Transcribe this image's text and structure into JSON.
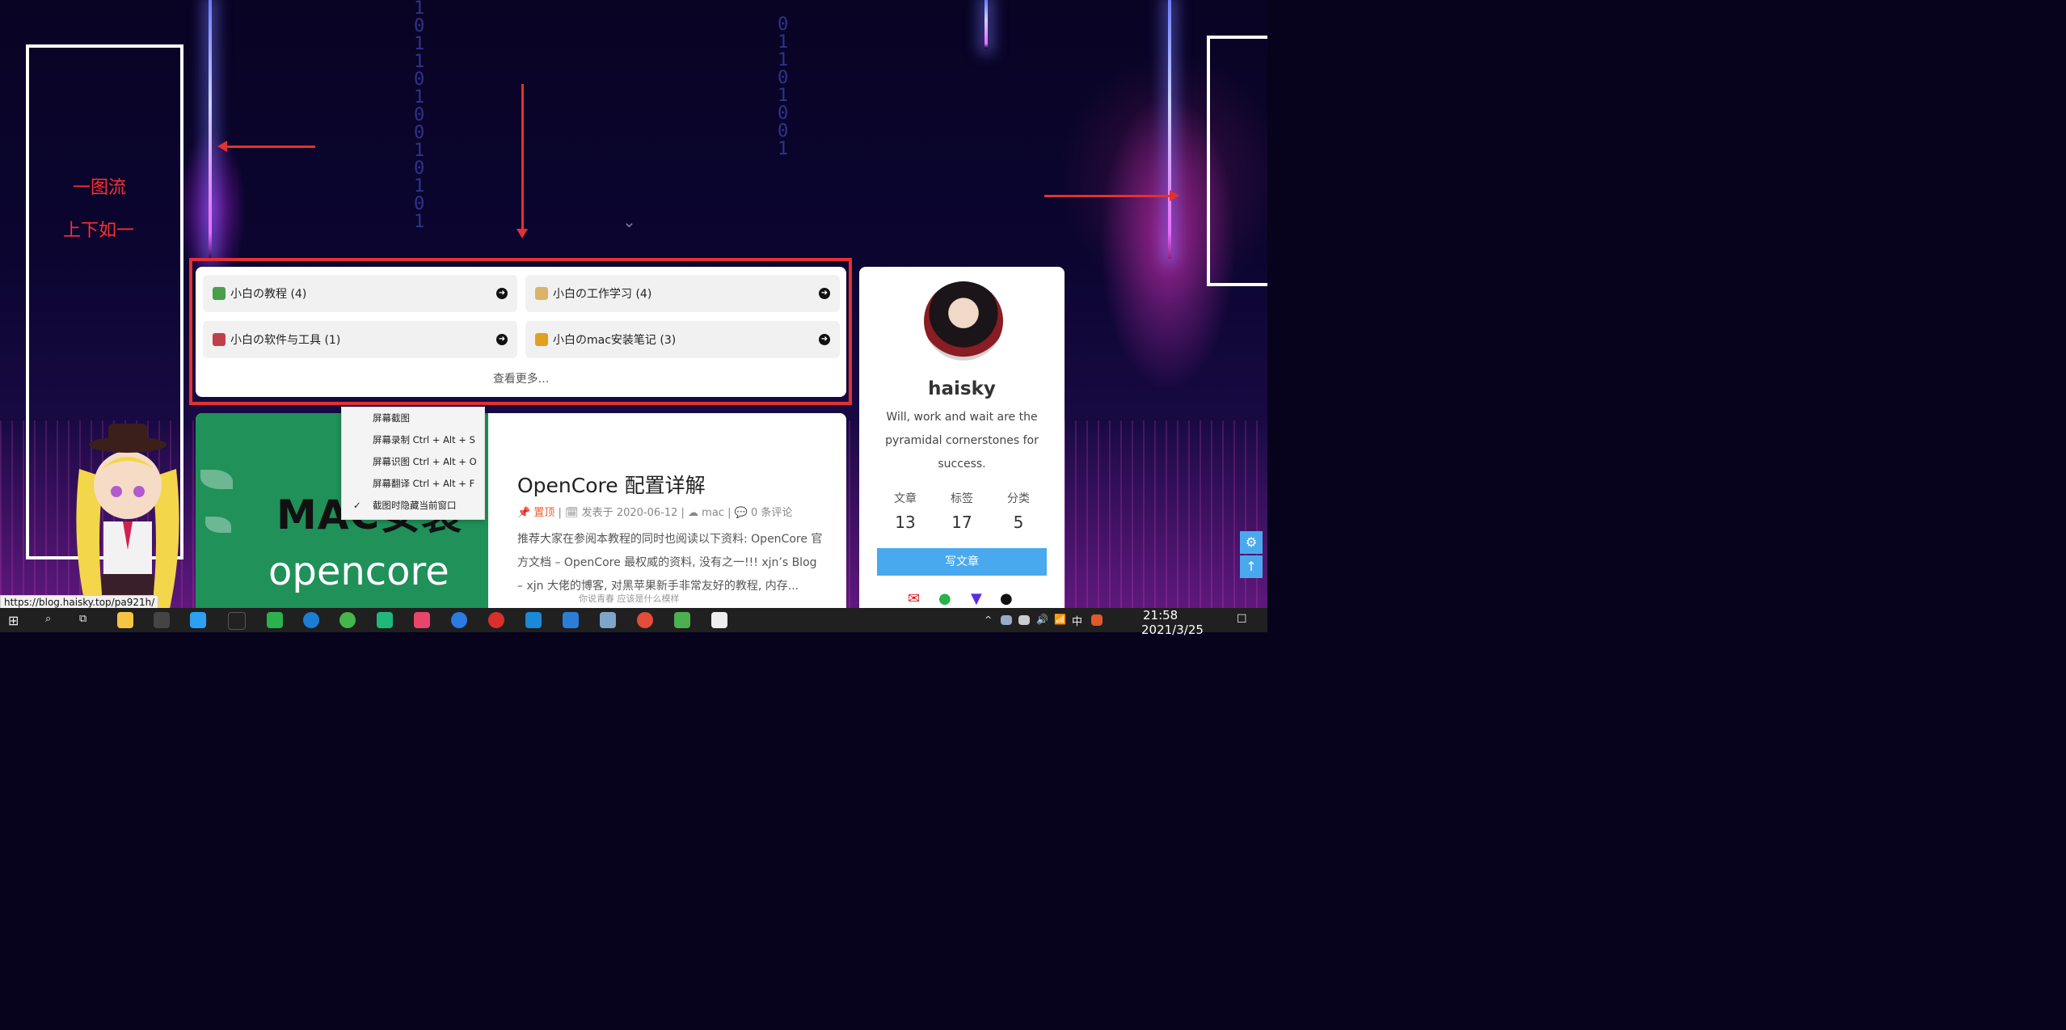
{
  "annotations": {
    "left_text_1": "一图流",
    "left_text_2": "上下如一"
  },
  "hero": {
    "scroll_icon": "chevron-down-icon"
  },
  "categories": [
    {
      "label": "小白の教程 (4)",
      "icon": "book-icon",
      "color": "#4a9e4a"
    },
    {
      "label": "小白の工作学习 (4)",
      "icon": "memo-icon",
      "color": "#d9b46a"
    },
    {
      "label": "小白の软件与工具 (1)",
      "icon": "toolbox-icon",
      "color": "#c0404a"
    },
    {
      "label": "小白のmac安装笔记 (3)",
      "icon": "computer-icon",
      "color": "#e0a020"
    }
  ],
  "categories_more": "查看更多...",
  "context_menu": [
    {
      "label": "屏幕截图",
      "checked": false
    },
    {
      "label": "屏幕录制 Ctrl + Alt + S",
      "checked": false
    },
    {
      "label": "屏幕识图 Ctrl + Alt + O",
      "checked": false
    },
    {
      "label": "屏幕翻译 Ctrl + Alt + F",
      "checked": false
    },
    {
      "label": "截图时隐藏当前窗口",
      "checked": true
    }
  ],
  "post": {
    "image_title": "MAC安装",
    "image_subtitle": "opencore",
    "title": "OpenCore 配置详解",
    "pinned": "置顶",
    "date_prefix": "发表于",
    "date": "2020-06-12",
    "category": "mac",
    "comments": "0 条评论",
    "excerpt": "推荐大家在参阅本教程的同时也阅读以下资料: OpenCore 官方文档 – OpenCore 最权威的资料, 没有之一!!! xjn’s Blog – xjn 大佬的博客, 对黑苹果新手非常友好的教程, 内存..."
  },
  "profile": {
    "name": "haisky",
    "bio": "Will, work and wait are the pyramidal cornerstones for success.",
    "stats": [
      {
        "label": "文章",
        "value": "13"
      },
      {
        "label": "标签",
        "value": "17"
      },
      {
        "label": "分类",
        "value": "5"
      }
    ],
    "write_button": "写文章",
    "social": [
      "mail-icon",
      "wechat-icon",
      "shirt-icon",
      "github-icon"
    ]
  },
  "status_url": "https://blog.haisky.top/pa921h/",
  "footer_text": "你说青春 应该是什么模样",
  "taskbar": {
    "ime": "中",
    "time": "21:58",
    "date": "2021/3/25"
  },
  "colors": {
    "accent": "#49a9ee",
    "annotation": "#e53030",
    "pin": "#f55a2c"
  }
}
